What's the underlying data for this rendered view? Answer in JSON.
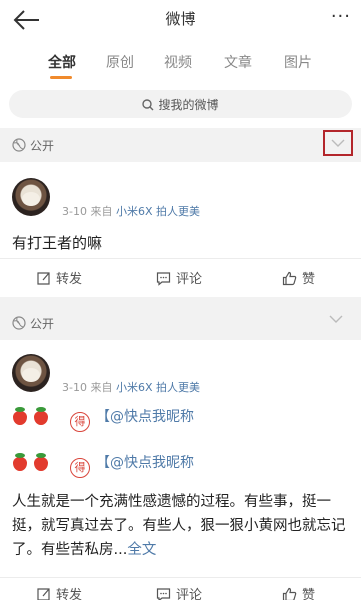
{
  "topbar": {
    "title": "微博",
    "more": "···"
  },
  "tabs": [
    "全部",
    "原创",
    "视频",
    "文章",
    "图片"
  ],
  "search": {
    "label": "搜我的微博"
  },
  "posts": [
    {
      "visibility": "公开",
      "date": "3-10",
      "source_prefix": "来自",
      "source": "小米6X 拍人更美",
      "text": "有打王者的嘛",
      "actions": {
        "repost": "转发",
        "comment": "评论",
        "like": "赞"
      }
    },
    {
      "visibility": "公开",
      "date": "3-10",
      "source_prefix": "来自",
      "source": "小米6X 拍人更美",
      "badge": "得",
      "mention_line_1": "【@快点我昵称",
      "mention_line_2": "【@快点我昵称",
      "text": "人生就是一个充满性感遗憾的过程。有些事，挺一挺，就写真过去了。有些人，狠一狠小黄网也就忘记了。有些苦私房...",
      "more": "全文",
      "actions": {
        "repost": "转发",
        "comment": "评论",
        "like": "赞"
      }
    }
  ],
  "colors": {
    "accent": "#f08a2c",
    "link": "#4f7aa8",
    "highlight_box": "#b3262b"
  }
}
